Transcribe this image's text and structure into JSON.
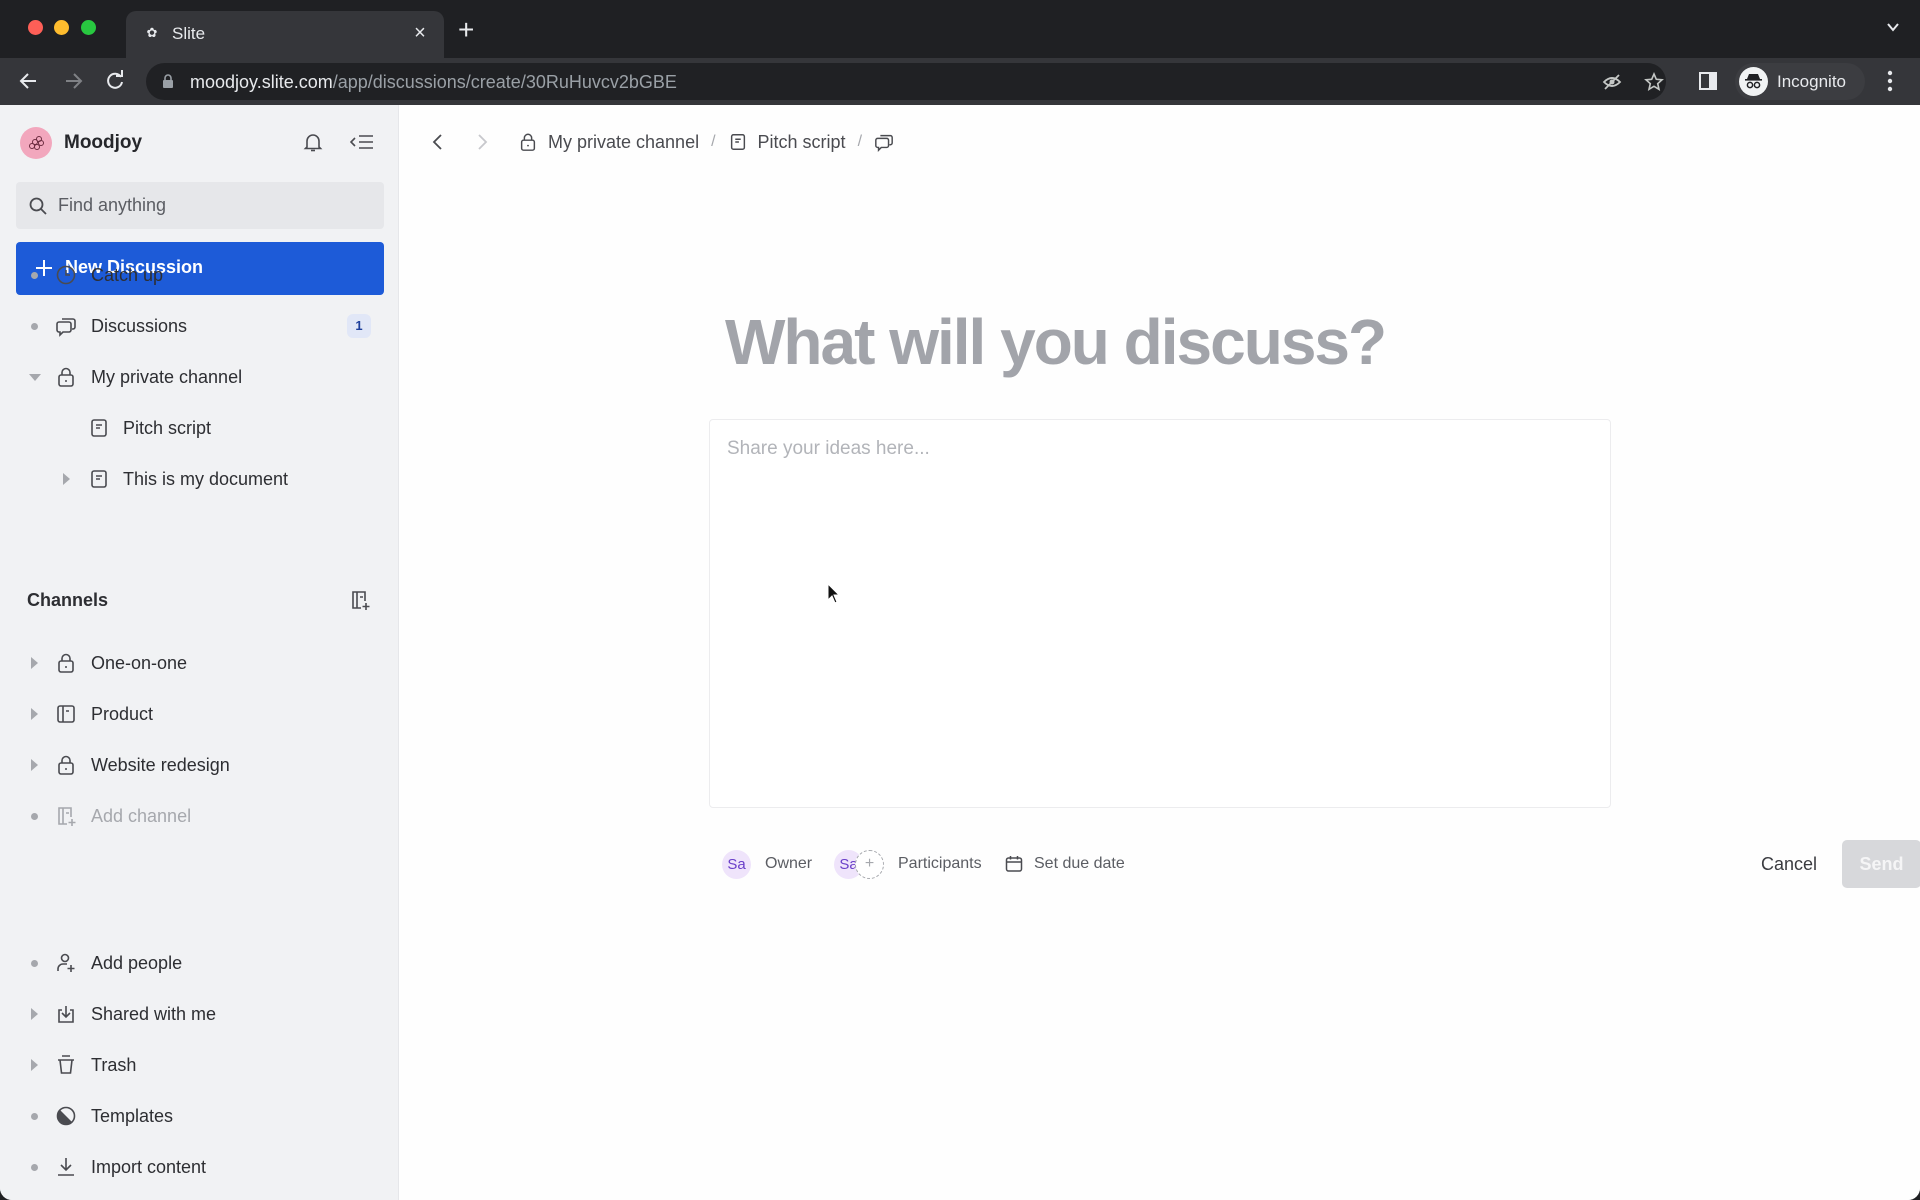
{
  "browser": {
    "tab_title": "Slite",
    "tab_favicon": "slite-logo-icon",
    "url_host": "moodjoy.slite.com",
    "url_path": "/app/discussions/create/30RuHuvcv2bGBE",
    "profile_label": "Incognito"
  },
  "sidebar": {
    "workspace_name": "Moodjoy",
    "search_placeholder": "Find anything",
    "new_discussion_label": "New Discussion",
    "top_items": [
      {
        "label": "Catch up",
        "icon": "clock-icon"
      },
      {
        "label": "Discussions",
        "icon": "chat-bubbles-icon",
        "badge": "1"
      },
      {
        "label": "My private channel",
        "icon": "lock-icon",
        "expanded": true
      },
      {
        "label": "Pitch script",
        "icon": "document-icon"
      },
      {
        "label": "This is my document",
        "icon": "document-icon"
      }
    ],
    "channels_heading": "Channels",
    "channels": [
      {
        "label": "One-on-one",
        "icon": "lock-icon"
      },
      {
        "label": "Product",
        "icon": "channel-icon"
      },
      {
        "label": "Website redesign",
        "icon": "lock-icon"
      },
      {
        "label": "Add channel",
        "icon": "add-channel-icon"
      }
    ],
    "bottom_items": [
      {
        "label": "Add people",
        "icon": "add-person-icon"
      },
      {
        "label": "Shared with me",
        "icon": "inbox-download-icon"
      },
      {
        "label": "Trash",
        "icon": "trash-icon"
      },
      {
        "label": "Templates",
        "icon": "templates-icon"
      },
      {
        "label": "Import content",
        "icon": "import-icon"
      }
    ]
  },
  "main": {
    "breadcrumb": [
      {
        "label": "My private channel",
        "icon": "lock-icon"
      },
      {
        "label": "Pitch script",
        "icon": "document-icon"
      }
    ],
    "breadcrumb_separator": "/",
    "title_placeholder": "What will you discuss?",
    "editor_placeholder": "Share your ideas here...",
    "owner": {
      "initials": "Sa",
      "label": "Owner"
    },
    "participants": {
      "initials": "Sa",
      "add_symbol": "+",
      "label": "Participants"
    },
    "due_date_label": "Set due date",
    "cancel_label": "Cancel",
    "send_label": "Send",
    "help_label": "?"
  }
}
